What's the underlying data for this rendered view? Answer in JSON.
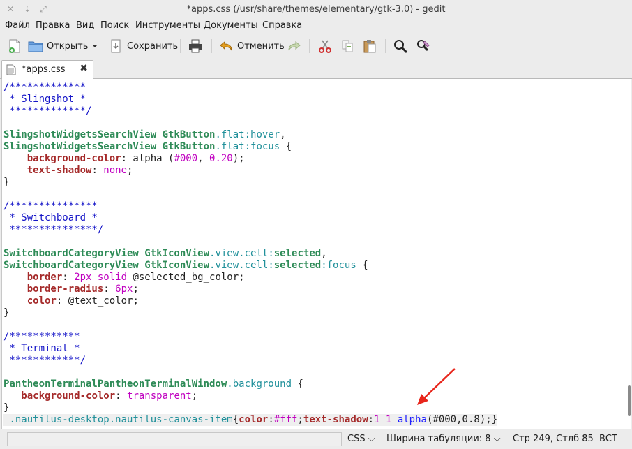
{
  "window": {
    "title": "*apps.css (/usr/share/themes/elementary/gtk-3.0) - gedit",
    "close_glyph": "✕",
    "minimize_glyph": "⇣",
    "maximize_glyph": "⤢"
  },
  "menu": [
    "Файл",
    "Правка",
    "Вид",
    "Поиск",
    "Инструменты",
    "Документы",
    "Справка"
  ],
  "toolbar": {
    "open_label": "Открыть",
    "save_label": "Сохранить",
    "undo_label": "Отменить",
    "icons": [
      "new-document-icon",
      "open-folder-icon",
      "dropdown-arrow-icon",
      "save-icon",
      "print-icon",
      "undo-icon",
      "redo-icon",
      "cut-icon",
      "copy-icon",
      "paste-icon",
      "search-icon",
      "find-replace-icon"
    ]
  },
  "tab": {
    "label": "*apps.css",
    "close_glyph": "✖"
  },
  "editor": {
    "lines": [
      [
        [
          "c",
          "/*************"
        ]
      ],
      [
        [
          "c",
          " * Slingshot *"
        ]
      ],
      [
        [
          "c",
          " *************/"
        ]
      ],
      [
        [
          "",
          ""
        ]
      ],
      [
        [
          "sel",
          "SlingshotWidgetsSearchView GtkButton"
        ],
        [
          "cls",
          ".flat"
        ],
        [
          "pc",
          ":hover"
        ],
        [
          "",
          ","
        ]
      ],
      [
        [
          "sel",
          "SlingshotWidgetsSearchView GtkButton"
        ],
        [
          "cls",
          ".flat"
        ],
        [
          "pc",
          ":focus"
        ],
        [
          "",
          " {"
        ]
      ],
      [
        [
          "",
          "    "
        ],
        [
          "pr",
          "background-color"
        ],
        [
          "",
          ": alpha ("
        ],
        [
          "val",
          "#000"
        ],
        [
          "",
          ", "
        ],
        [
          "val",
          "0.20"
        ],
        [
          "",
          ");"
        ]
      ],
      [
        [
          "",
          "    "
        ],
        [
          "pr",
          "text-shadow"
        ],
        [
          "",
          ": "
        ],
        [
          "val",
          "none"
        ],
        [
          "",
          ";"
        ]
      ],
      [
        [
          "",
          "}"
        ]
      ],
      [
        [
          "",
          ""
        ]
      ],
      [
        [
          "c",
          "/***************"
        ]
      ],
      [
        [
          "c",
          " * Switchboard *"
        ]
      ],
      [
        [
          "c",
          " ***************/"
        ]
      ],
      [
        [
          "",
          ""
        ]
      ],
      [
        [
          "sel",
          "SwitchboardCategoryView GtkIconView"
        ],
        [
          "cls",
          ".view.cell"
        ],
        [
          "pc",
          ":"
        ],
        [
          "sel",
          "selected"
        ],
        [
          "",
          ","
        ]
      ],
      [
        [
          "sel",
          "SwitchboardCategoryView GtkIconView"
        ],
        [
          "cls",
          ".view.cell"
        ],
        [
          "pc",
          ":"
        ],
        [
          "sel",
          "selected"
        ],
        [
          "pc",
          ":focus"
        ],
        [
          "",
          " {"
        ]
      ],
      [
        [
          "",
          "    "
        ],
        [
          "pr",
          "border"
        ],
        [
          "",
          ": "
        ],
        [
          "val",
          "2px solid"
        ],
        [
          "",
          " @selected_bg_color;"
        ]
      ],
      [
        [
          "",
          "    "
        ],
        [
          "pr",
          "border-radius"
        ],
        [
          "",
          ": "
        ],
        [
          "val",
          "6px"
        ],
        [
          "",
          ";"
        ]
      ],
      [
        [
          "",
          "    "
        ],
        [
          "pr",
          "color"
        ],
        [
          "",
          ": @text_color;"
        ]
      ],
      [
        [
          "",
          "}"
        ]
      ],
      [
        [
          "",
          ""
        ]
      ],
      [
        [
          "c",
          "/************"
        ]
      ],
      [
        [
          "c",
          " * Terminal *"
        ]
      ],
      [
        [
          "c",
          " ************/"
        ]
      ],
      [
        [
          "",
          ""
        ]
      ],
      [
        [
          "sel",
          "PantheonTerminalPantheonTerminalWindow"
        ],
        [
          "cls",
          ".background"
        ],
        [
          "",
          " {"
        ]
      ],
      [
        [
          "",
          "   "
        ],
        [
          "pr",
          "background-color"
        ],
        [
          "",
          ": "
        ],
        [
          "val",
          "transparent"
        ],
        [
          "",
          ";"
        ]
      ],
      [
        [
          "",
          "}"
        ]
      ],
      [
        [
          "",
          " "
        ],
        [
          "cls",
          ".nautilus-desktop.nautilus-canvas-item"
        ],
        [
          "",
          "{"
        ],
        [
          "pr",
          "color"
        ],
        [
          "",
          ":"
        ],
        [
          "val",
          "#fff"
        ],
        [
          "",
          ";"
        ],
        [
          "pr",
          "text-shadow"
        ],
        [
          "",
          ":"
        ],
        [
          "val",
          "1 1"
        ],
        [
          "",
          " "
        ],
        [
          "fn",
          "alpha"
        ],
        [
          "",
          "(#000,0.8);}"
        ]
      ]
    ]
  },
  "statusbar": {
    "language": "CSS",
    "tab_width": "Ширина табуляции: 8",
    "position": "Стр 249, Стлб 85",
    "mode": "ВСТ"
  },
  "colors": {
    "comment": "#1515c8",
    "selector": "#2e8b57",
    "property": "#a52a2a",
    "value": "#c000c0",
    "annotation_arrow": "#e8261c"
  }
}
